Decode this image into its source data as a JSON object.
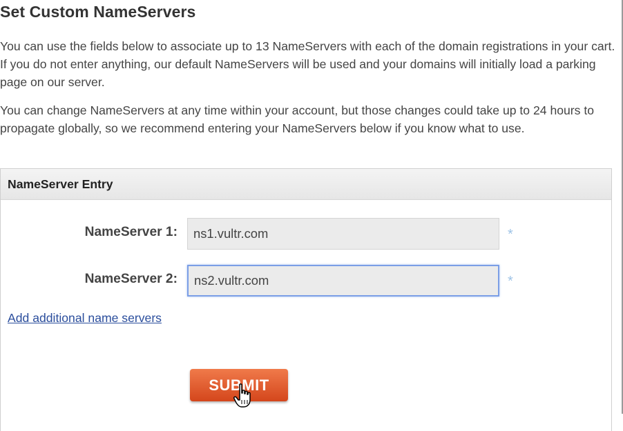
{
  "title": "Set Custom NameServers",
  "intro": {
    "paragraph1": "You can use the fields below to associate up to 13 NameServers with each of the domain registrations in your cart. If you do not enter anything, our default NameServers will be used and your domains will initially load a parking page on our server.",
    "paragraph2": "You can change NameServers at any time within your account, but those changes could take up to 24 hours to propagate globally, so we recommend entering your NameServers below if you know what to use."
  },
  "panel": {
    "header": "NameServer Entry",
    "fields": [
      {
        "label": "NameServer 1:",
        "value": "ns1.vultr.com",
        "required_marker": "*"
      },
      {
        "label": "NameServer 2:",
        "value": "ns2.vultr.com",
        "required_marker": "*"
      }
    ],
    "add_link": "Add additional name servers",
    "submit_label": "SUBMIT"
  },
  "colors": {
    "submit_button": "#e05a2c",
    "link": "#2a4d9c",
    "focus_ring": "#7b9ee6",
    "required_marker": "#9ec3e6"
  },
  "icons": {
    "cursor": "hand-pointer-icon",
    "required": "asterisk-icon"
  }
}
